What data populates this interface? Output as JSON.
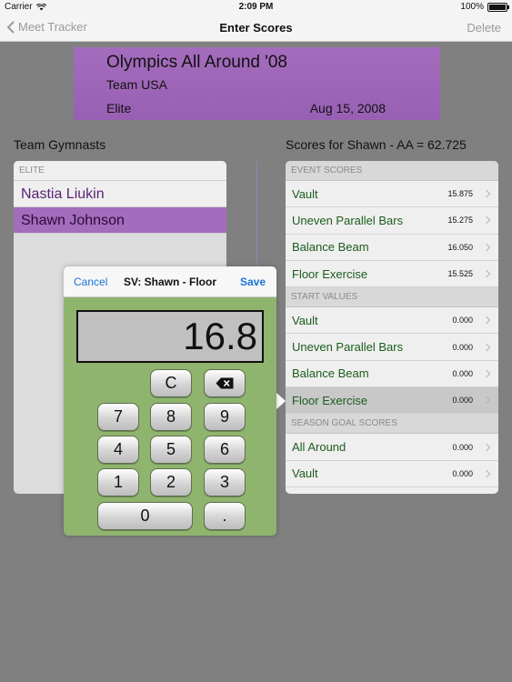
{
  "status": {
    "carrier": "Carrier",
    "time": "2:09 PM",
    "battery": "100%"
  },
  "nav": {
    "back": "Meet Tracker",
    "title": "Enter Scores",
    "delete": "Delete"
  },
  "meet": {
    "name": "Olympics All Around '08",
    "team": "Team USA",
    "level": "Elite",
    "date": "Aug 15, 2008"
  },
  "gymnasts": {
    "title": "Team Gymnasts",
    "group": "ELITE",
    "items": [
      "Nastia Liukin",
      "Shawn Johnson"
    ]
  },
  "scores": {
    "title": "Scores for Shawn - AA = 62.725",
    "event_header": "EVENT SCORES",
    "event": [
      {
        "label": "Vault",
        "value": "15.875"
      },
      {
        "label": "Uneven Parallel Bars",
        "value": "15.275"
      },
      {
        "label": "Balance Beam",
        "value": "16.050"
      },
      {
        "label": "Floor Exercise",
        "value": "15.525"
      }
    ],
    "start_header": "START VALUES",
    "start": [
      {
        "label": "Vault",
        "value": "0.000"
      },
      {
        "label": "Uneven Parallel Bars",
        "value": "0.000"
      },
      {
        "label": "Balance Beam",
        "value": "0.000"
      },
      {
        "label": "Floor Exercise",
        "value": "0.000"
      }
    ],
    "goal_header": "SEASON GOAL SCORES",
    "goal": [
      {
        "label": "All Around",
        "value": "0.000"
      },
      {
        "label": "Vault",
        "value": "0.000"
      }
    ]
  },
  "popover": {
    "cancel": "Cancel",
    "title": "SV: Shawn - Floor",
    "save": "Save",
    "display": "16.8",
    "keys": {
      "clear": "C",
      "k7": "7",
      "k8": "8",
      "k9": "9",
      "k4": "4",
      "k5": "5",
      "k6": "6",
      "k1": "1",
      "k2": "2",
      "k3": "3",
      "k0": "0",
      "dot": "."
    }
  },
  "colors": {
    "accent_purple": "#a46cbc",
    "label_green": "#1c5c1c",
    "keypad_green": "#8fb46e",
    "link_blue": "#1a73d9"
  }
}
